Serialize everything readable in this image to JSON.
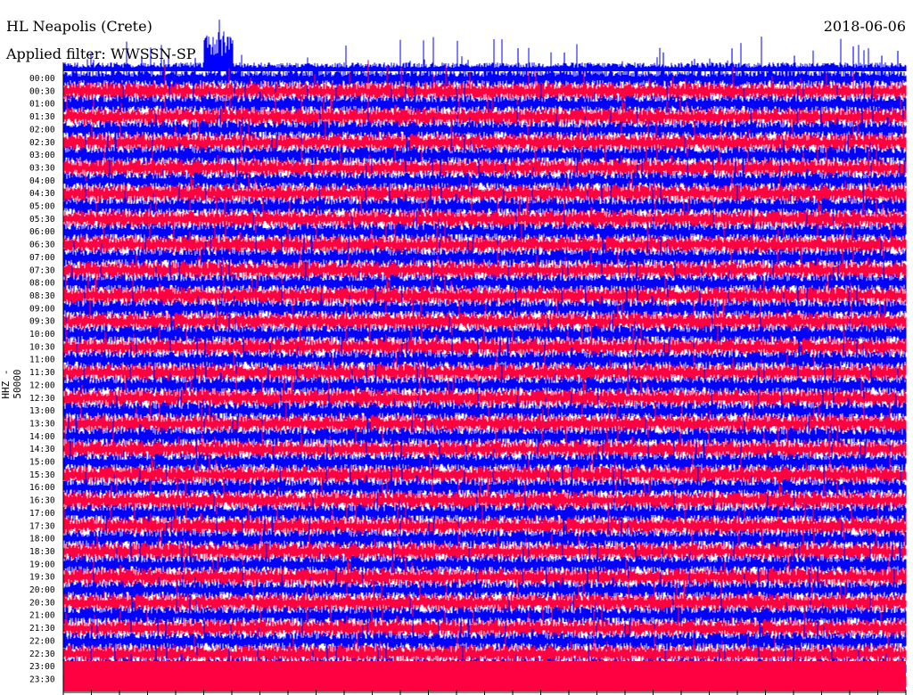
{
  "header": {
    "station": "HL Neapolis (Crete)",
    "date": "2018-06-06",
    "filter": "Applied filter: WWSSN-SP"
  },
  "chart_data": {
    "type": "line",
    "channel_label": "HHZ - 50000",
    "ylabels": [
      "00:00",
      "00:30",
      "01:00",
      "01:30",
      "02:00",
      "02:30",
      "03:00",
      "03:30",
      "04:00",
      "04:30",
      "05:00",
      "05:30",
      "06:00",
      "06:30",
      "07:00",
      "07:30",
      "08:00",
      "08:30",
      "09:00",
      "09:30",
      "10:00",
      "10:30",
      "11:00",
      "11:30",
      "12:00",
      "12:30",
      "13:00",
      "13:30",
      "14:00",
      "14:30",
      "15:00",
      "15:30",
      "16:00",
      "16:30",
      "17:00",
      "17:30",
      "18:00",
      "18:30",
      "19:00",
      "19:30",
      "20:00",
      "20:30",
      "21:00",
      "21:30",
      "22:00",
      "22:30",
      "23:00",
      "23:30"
    ],
    "trace_colors": [
      "#0000ff",
      "#ff0040"
    ],
    "axis_color": "#000000",
    "grid": false
  }
}
